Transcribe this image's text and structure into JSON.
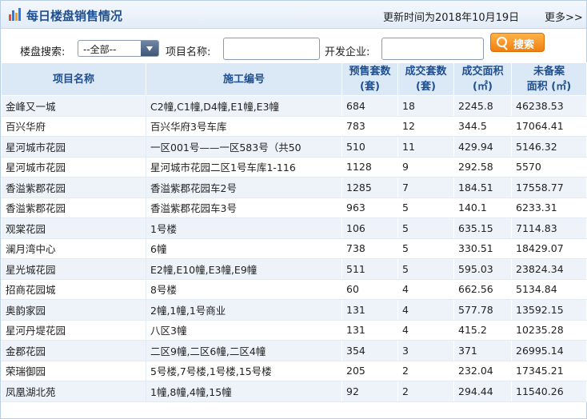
{
  "header": {
    "title": "每日楼盘销售情况",
    "update_time": "更新时间为2018年10月19日",
    "more": "更多>>"
  },
  "search": {
    "property_label": "楼盘搜索:",
    "select_value": "--全部--",
    "project_label": "项目名称:",
    "developer_label": "开发企业:",
    "button_label": "搜索"
  },
  "table": {
    "headers": [
      [
        "项目名称",
        ""
      ],
      [
        "施工编号",
        ""
      ],
      [
        "预售套数",
        "(套)"
      ],
      [
        "成交套数",
        "(套)"
      ],
      [
        "成交面积",
        "(㎡)"
      ],
      [
        "未备案",
        "面积 (㎡)"
      ]
    ],
    "rows": [
      [
        "金峰又一城",
        "C2幢,C1幢,D4幢,E1幢,E3幢",
        "684",
        "18",
        "2245.8",
        "46238.53"
      ],
      [
        "百兴华府",
        "百兴华府3号车库",
        "783",
        "12",
        "344.5",
        "17064.41"
      ],
      [
        "星河城市花园",
        "一区001号——一区583号（共50",
        "510",
        "11",
        "429.94",
        "5146.32"
      ],
      [
        "星河城市花园",
        "星河城市花园二区1号车库1-116",
        "1128",
        "9",
        "292.58",
        "5570"
      ],
      [
        "香溢紫郡花园",
        "香溢紫郡花园车2号",
        "1285",
        "7",
        "184.51",
        "17558.77"
      ],
      [
        "香溢紫郡花园",
        "香溢紫郡花园车3号",
        "963",
        "5",
        "140.1",
        "6233.31"
      ],
      [
        "观棠花园",
        "1号楼",
        "106",
        "5",
        "635.15",
        "7114.83"
      ],
      [
        "澜月湾中心",
        "6幢",
        "738",
        "5",
        "330.51",
        "18429.07"
      ],
      [
        "星光城花园",
        "E2幢,E10幢,E3幢,E9幢",
        "511",
        "5",
        "595.03",
        "23824.34"
      ],
      [
        "招商花园城",
        "8号楼",
        "60",
        "4",
        "662.56",
        "5134.84"
      ],
      [
        "奥韵家园",
        "2幢,1幢,1号商业",
        "131",
        "4",
        "577.78",
        "13592.15"
      ],
      [
        "星河丹堤花园",
        "八区3幢",
        "131",
        "4",
        "415.2",
        "10235.28"
      ],
      [
        "金郡花园",
        "二区9幢,二区6幢,二区4幢",
        "354",
        "3",
        "371",
        "26995.14"
      ],
      [
        "荣瑞御园",
        "5号楼,7号楼,1号楼,15号楼",
        "205",
        "2",
        "232.04",
        "17345.21"
      ],
      [
        "凤凰湖北苑",
        "1幢,8幢,4幢,15幢",
        "92",
        "2",
        "294.44",
        "11540.26"
      ]
    ]
  },
  "icons": {
    "logo": "bar-chart-icon",
    "search": "magnifier-icon",
    "dropdown": "chevron-down-icon"
  },
  "colors": {
    "title": "#1f4f8f",
    "header_bg": "#dbe8f6",
    "row_alt": "#eef3fa",
    "button": "#f07f12"
  }
}
